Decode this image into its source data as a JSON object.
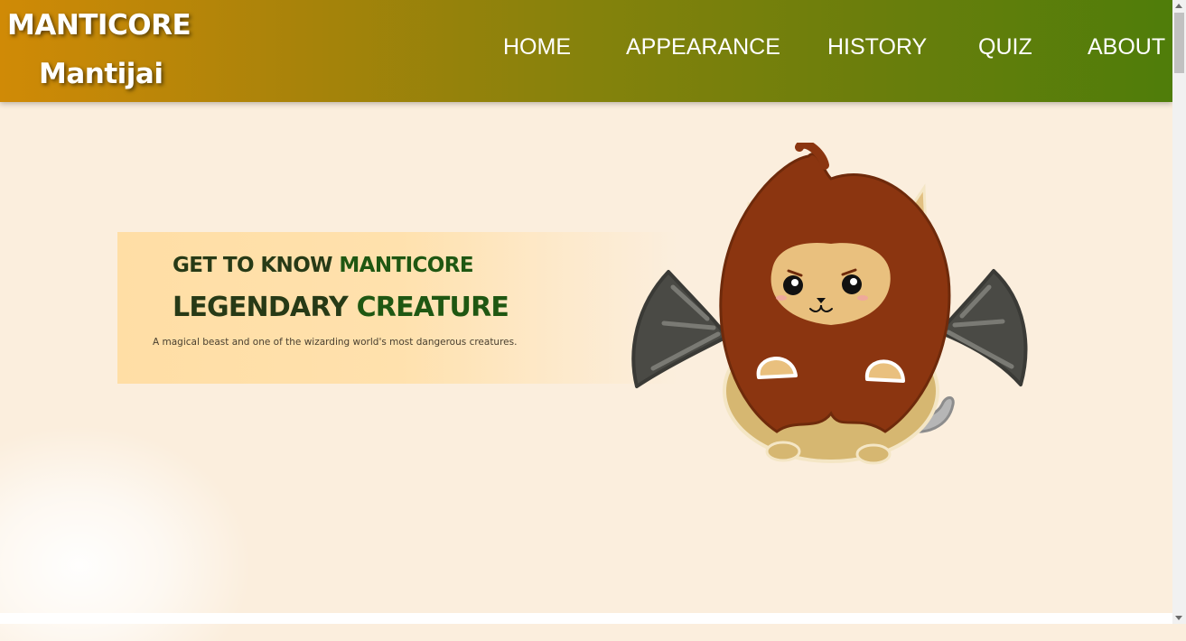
{
  "header": {
    "logo_title": "MANTICORE",
    "logo_subtitle": "Mantijai",
    "nav": [
      "HOME",
      "APPEARANCE",
      "HISTORY",
      "QUIZ",
      "ABOUT"
    ]
  },
  "hero": {
    "line1_dark": "GET TO KNOW ",
    "line1_green": "MANTICORE",
    "line2_dark": "LEGENDARY ",
    "line2_green": "CREATURE",
    "description": "A magical beast and one of the wizarding world's most dangerous creatures."
  },
  "colors": {
    "header_gradient_start": "#d08a06",
    "header_gradient_end": "#4f7d0a",
    "page_background": "#fbeedd",
    "hero_card": "#ffdea5",
    "heading_dark": "#273a16",
    "heading_green": "#1f5712"
  },
  "icons": [
    "manticore-mascot",
    "cloud-decoration",
    "scrollbar-up-arrow",
    "scrollbar-down-arrow"
  ]
}
